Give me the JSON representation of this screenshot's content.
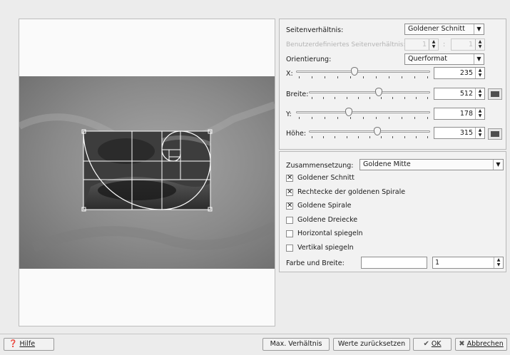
{
  "settings": {
    "aspect_label": "Seitenverhältnis:",
    "aspect_value": "Goldener Schnitt",
    "custom_ratio_label": "Benutzerdefiniertes Seitenverhältnis:",
    "custom_ratio_a": "1",
    "custom_ratio_sep": ":",
    "custom_ratio_b": "1",
    "orientation_label": "Orientierung:",
    "orientation_value": "Querformat",
    "x": {
      "label": "X:",
      "value": "235",
      "position": 0.43
    },
    "width": {
      "label": "Breite:",
      "value": "512",
      "position": 0.58
    },
    "y": {
      "label": "Y:",
      "value": "178",
      "position": 0.39
    },
    "height": {
      "label": "Höhe:",
      "value": "315",
      "position": 0.57
    }
  },
  "composition": {
    "label": "Zusammensetzung:",
    "value": "Goldene Mitte",
    "checkboxes": [
      {
        "label": "Goldener Schnitt",
        "checked": true
      },
      {
        "label": "Rechtecke der goldenen Spirale",
        "checked": true
      },
      {
        "label": "Goldene Spirale",
        "checked": true
      },
      {
        "label": "Goldene Dreiecke",
        "checked": false
      },
      {
        "label": "Horizontal spiegeln",
        "checked": false
      },
      {
        "label": "Vertikal spiegeln",
        "checked": false
      }
    ],
    "color_width_label": "Farbe und Breite:",
    "line_width": "1"
  },
  "buttons": {
    "help": "Hilfe",
    "max_ratio": "Max. Verhältnis",
    "reset": "Werte zurücksetzen",
    "ok": "OK",
    "cancel": "Abbrechen"
  },
  "colors": {
    "guide_lines": "#ffffff",
    "panel_bg": "#f2f2f2",
    "window_bg": "#ececec"
  }
}
